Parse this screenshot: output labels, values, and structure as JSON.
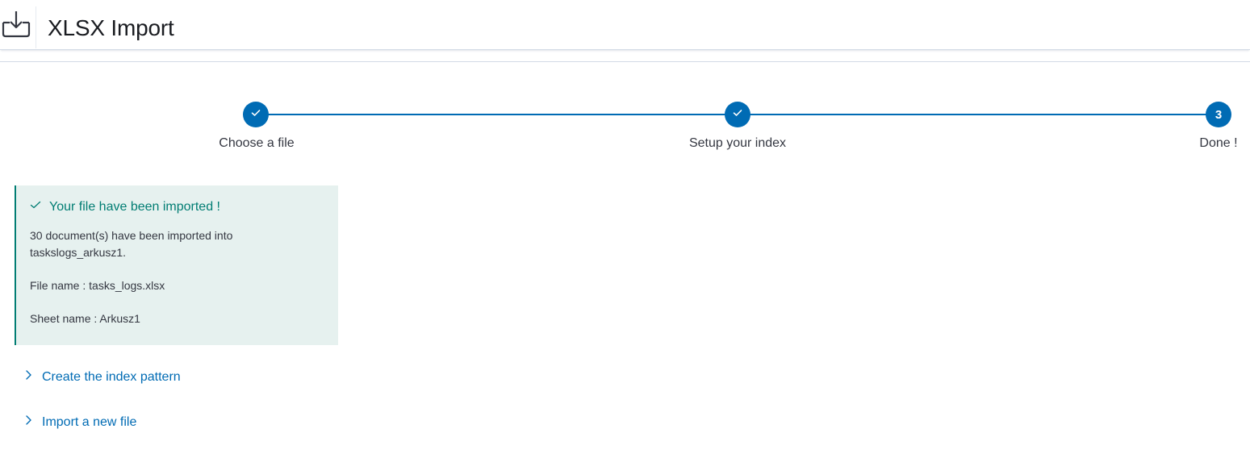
{
  "header": {
    "icon": "import-icon",
    "title": "XLSX Import"
  },
  "steps": [
    {
      "label": "Choose a file",
      "state": "complete",
      "icon": "check-icon"
    },
    {
      "label": "Setup your index",
      "state": "complete",
      "icon": "check-icon"
    },
    {
      "label": "Done !",
      "state": "current",
      "number": "3"
    }
  ],
  "callout": {
    "icon": "check-icon",
    "title": "Your file have been imported !",
    "message": "30 document(s) have been imported into taskslogs_arkusz1.",
    "file_name": "File name : tasks_logs.xlsx",
    "sheet_name": "Sheet name : Arkusz1"
  },
  "actions": [
    {
      "label": "Create the index pattern",
      "icon": "chevron-right-icon"
    },
    {
      "label": "Import a new file",
      "icon": "chevron-right-icon"
    }
  ],
  "colors": {
    "primary": "#006bb4",
    "success": "#017d73",
    "success_bg": "#e6f1ef"
  }
}
